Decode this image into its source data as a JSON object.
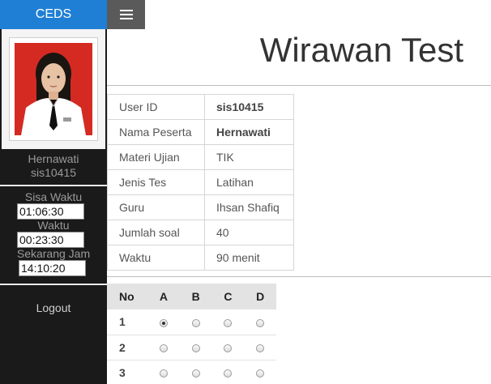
{
  "sidebar": {
    "brand": "CEDS",
    "user_name": "Hernawati",
    "user_id": "sis10415",
    "timers": {
      "sisa_waktu_label": "Sisa Waktu",
      "sisa_waktu_value": "01:06:30",
      "waktu_label": "Waktu",
      "waktu_value": "00:23:30",
      "sekarang_label": "Sekarang Jam",
      "sekarang_value": "14:10:20"
    },
    "logout_label": "Logout"
  },
  "header": {
    "title": "Wirawan Test"
  },
  "info": {
    "rows": [
      {
        "key": "User ID",
        "value": "sis10415"
      },
      {
        "key": "Nama Peserta",
        "value": "Hernawati"
      },
      {
        "key": "Materi Ujian",
        "value": "TIK"
      },
      {
        "key": "Jenis Tes",
        "value": "Latihan"
      },
      {
        "key": "Guru",
        "value": "Ihsan Shafiq"
      },
      {
        "key": "Jumlah soal",
        "value": "40"
      },
      {
        "key": "Waktu",
        "value": "90 menit"
      }
    ]
  },
  "answers": {
    "headers": [
      "No",
      "A",
      "B",
      "C",
      "D"
    ],
    "rows": [
      {
        "no": "1",
        "selected": "A"
      },
      {
        "no": "2",
        "selected": ""
      },
      {
        "no": "3",
        "selected": ""
      }
    ]
  },
  "colors": {
    "brand_bar": "#1f7fd4",
    "sidebar_bg": "#1a1a1a",
    "hamburger_bg": "#5a5a5a",
    "photo_background": "#d42a22"
  },
  "icons": {
    "menu": "hamburger-menu-icon"
  }
}
